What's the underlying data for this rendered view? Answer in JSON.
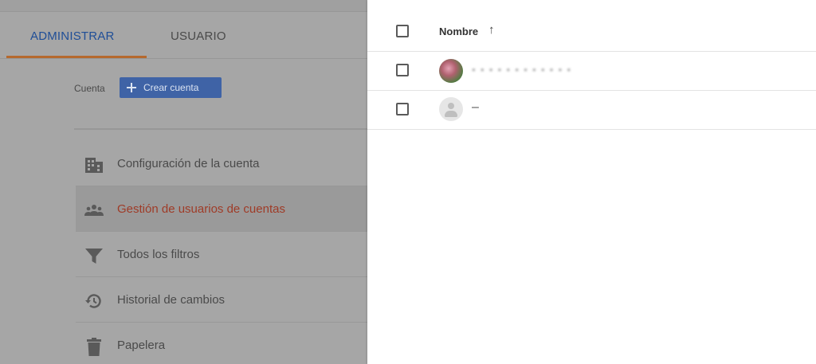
{
  "tabs": {
    "admin": "ADMINISTRAR",
    "user": "USUARIO"
  },
  "account": {
    "label": "Cuenta",
    "create_button": "Crear cuenta"
  },
  "menu": [
    {
      "label": "Configuración de la cuenta",
      "icon": "building-icon",
      "active": false
    },
    {
      "label": "Gestión de usuarios de cuentas",
      "icon": "people-icon",
      "active": true
    },
    {
      "label": "Todos los filtros",
      "icon": "filter-icon",
      "active": false
    },
    {
      "label": "Historial de cambios",
      "icon": "history-icon",
      "active": false
    },
    {
      "label": "Papelera",
      "icon": "trash-icon",
      "active": false
    }
  ],
  "users_table": {
    "column_name": "Nombre",
    "sort_indicator": "↑",
    "rows": [
      {
        "name": "▪ ▪ ▪ ▪ ▪  ▪  ▪ ▪ ▪ ▪ ▪ ▪",
        "avatar": "photo"
      },
      {
        "name": "–",
        "avatar": "default"
      }
    ]
  },
  "colors": {
    "accent_tab": "#1f4e97",
    "tab_underline": "#b5692e",
    "active_menu_text": "#9f3b27",
    "create_button_bg": "#3f63a6"
  }
}
